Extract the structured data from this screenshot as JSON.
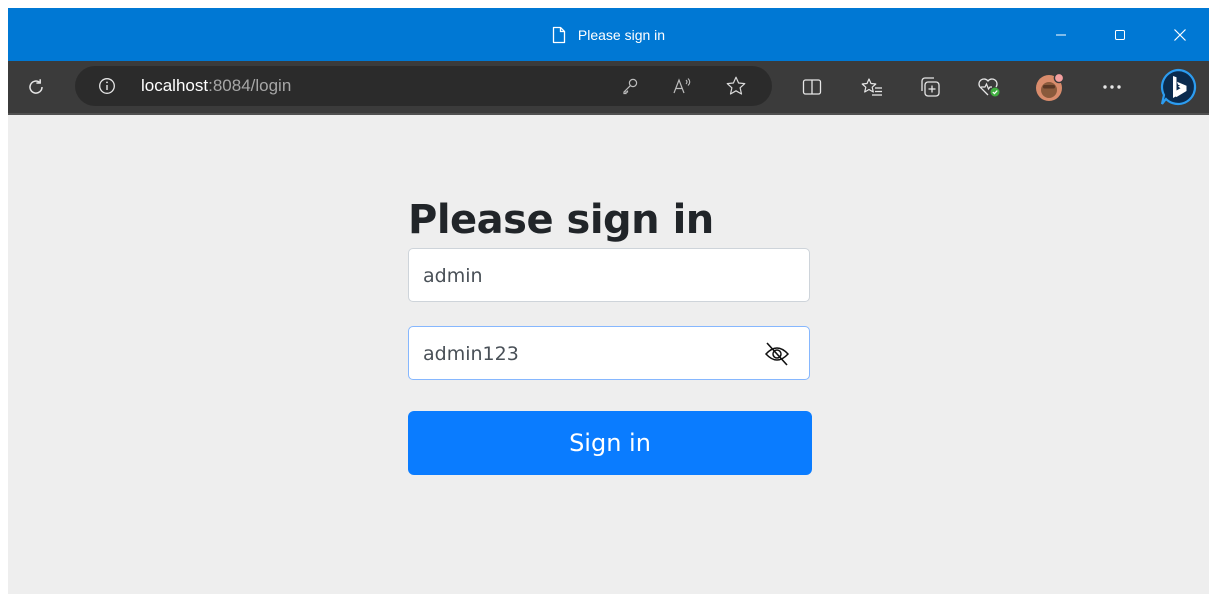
{
  "window": {
    "title": "Please sign in"
  },
  "toolbar": {
    "url_host": "localhost",
    "url_rest": ":8084/login"
  },
  "form": {
    "heading": "Please sign in",
    "username_value": "admin",
    "password_value": "admin123",
    "submit_label": "Sign in"
  },
  "colors": {
    "titlebar": "#0078d4",
    "toolbar": "#3b3b3b",
    "page_background": "#eeeeee",
    "primary_button": "#0a7cff"
  },
  "icons": {
    "titlebar": [
      "page-icon",
      "minimize-icon",
      "maximize-icon",
      "close-icon"
    ],
    "toolbar": [
      "refresh-icon",
      "site-info-icon",
      "key-icon",
      "read-aloud-icon",
      "favorite-star-icon",
      "split-screen-icon",
      "favorites-icon",
      "collections-icon",
      "browser-essentials-icon",
      "profile-avatar-icon",
      "more-icon",
      "bing-copilot-icon"
    ],
    "form": [
      "hide-password-icon"
    ]
  }
}
